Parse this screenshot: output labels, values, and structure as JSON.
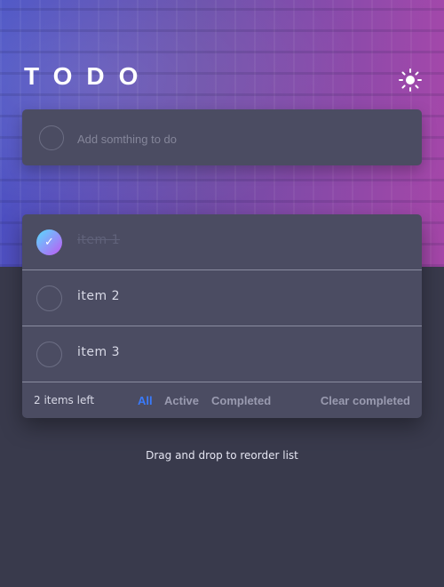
{
  "app": {
    "title": "TODO"
  },
  "theme_toggle": {
    "icon": "sun-icon"
  },
  "new_todo": {
    "placeholder": "Add somthing to do",
    "value": ""
  },
  "items": [
    {
      "label": "item 1",
      "completed": true
    },
    {
      "label": "item 2",
      "completed": false
    },
    {
      "label": "item 3",
      "completed": false
    }
  ],
  "footer": {
    "items_left": "2 items left",
    "filters": [
      "All",
      "Active",
      "Completed"
    ],
    "active_filter": "All",
    "clear_label": "Clear completed"
  },
  "hint": "Drag and drop to reorder list",
  "colors": {
    "background": "#393a4c",
    "card": "#4b4c62",
    "accent": "#3a7bfd",
    "check_gradient_start": "#57ddff",
    "check_gradient_end": "#c058f3"
  }
}
